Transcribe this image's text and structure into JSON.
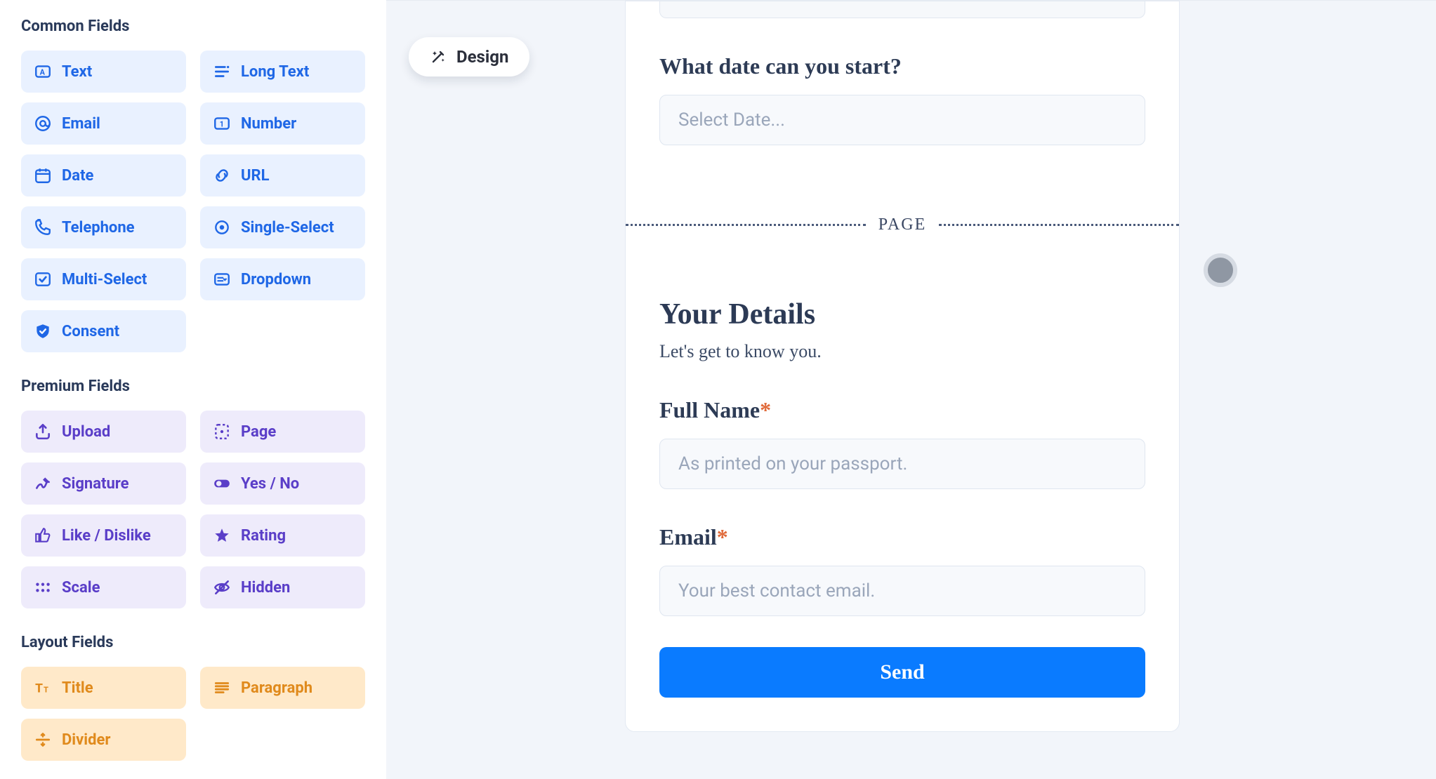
{
  "sidebar": {
    "sections": {
      "common": {
        "heading": "Common Fields",
        "items": [
          {
            "label": "Text",
            "icon": "text"
          },
          {
            "label": "Long Text",
            "icon": "longtext"
          },
          {
            "label": "Email",
            "icon": "email"
          },
          {
            "label": "Number",
            "icon": "number"
          },
          {
            "label": "Date",
            "icon": "date"
          },
          {
            "label": "URL",
            "icon": "url"
          },
          {
            "label": "Telephone",
            "icon": "telephone"
          },
          {
            "label": "Single-Select",
            "icon": "single"
          },
          {
            "label": "Multi-Select",
            "icon": "multi"
          },
          {
            "label": "Dropdown",
            "icon": "dropdown"
          },
          {
            "label": "Consent",
            "icon": "consent"
          }
        ]
      },
      "premium": {
        "heading": "Premium Fields",
        "items": [
          {
            "label": "Upload",
            "icon": "upload"
          },
          {
            "label": "Page",
            "icon": "page"
          },
          {
            "label": "Signature",
            "icon": "signature"
          },
          {
            "label": "Yes / No",
            "icon": "yesno"
          },
          {
            "label": "Like / Dislike",
            "icon": "like"
          },
          {
            "label": "Rating",
            "icon": "rating"
          },
          {
            "label": "Scale",
            "icon": "scale"
          },
          {
            "label": "Hidden",
            "icon": "hidden"
          }
        ]
      },
      "layout": {
        "heading": "Layout Fields",
        "items": [
          {
            "label": "Title",
            "icon": "title"
          },
          {
            "label": "Paragraph",
            "icon": "paragraph"
          },
          {
            "label": "Divider",
            "icon": "divider"
          }
        ]
      }
    }
  },
  "toolbar": {
    "design_label": "Design"
  },
  "form": {
    "q1_label": "What date can you start?",
    "q1_placeholder": "Select Date...",
    "page_divider_label": "PAGE",
    "details_title": "Your Details",
    "details_sub": "Let's get to know you.",
    "fullname_label": "Full Name",
    "fullname_placeholder": "As printed on your passport.",
    "email_label": "Email",
    "email_placeholder": "Your best contact email.",
    "send_label": "Send",
    "required_marker": "*"
  }
}
